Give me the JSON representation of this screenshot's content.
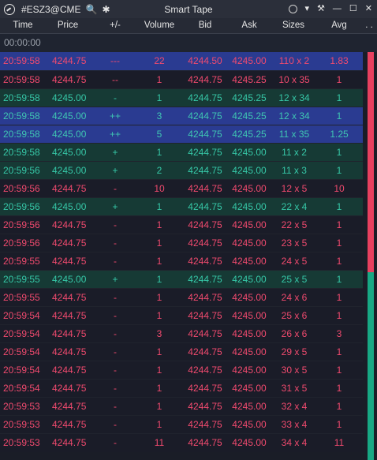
{
  "titlebar": {
    "symbol": "#ESZ3@CME",
    "search_icon": "🔍",
    "settings_icon": "✱",
    "title": "Smart Tape",
    "dropdown_icon": "▾",
    "pin_icon": "⚒",
    "minimize_icon": "—",
    "maximize_icon": "☐",
    "close_icon": "✕"
  },
  "columns": {
    "time": "Time",
    "price": "Price",
    "chg": "+/-",
    "volume": "Volume",
    "bid": "Bid",
    "ask": "Ask",
    "sizes": "Sizes",
    "avg": "Avg",
    "more": ". ."
  },
  "stamp": "00:00:00",
  "colors": {
    "buy_text": "#36c7a7",
    "sell_text": "#f04a6e",
    "highlight_bg": "#2a3b91",
    "buy_row_bg": "#163a35",
    "sell_row_bg": "#1a1c28"
  },
  "imbalance_bar": {
    "sell_fraction": 0.54,
    "buy_fraction": 0.46
  },
  "rows": [
    {
      "side": "sell",
      "hl": true,
      "time": "20:59:58",
      "price": "4244.75",
      "chg": "---",
      "volume": "22",
      "bid": "4244.50",
      "ask": "4245.00",
      "sizes": "110 x 2",
      "avg": "1.83"
    },
    {
      "side": "sell",
      "hl": false,
      "time": "20:59:58",
      "price": "4244.75",
      "chg": "--",
      "volume": "1",
      "bid": "4244.75",
      "ask": "4245.25",
      "sizes": "10 x 35",
      "avg": "1"
    },
    {
      "side": "buy",
      "hl": false,
      "time": "20:59:58",
      "price": "4245.00",
      "chg": "-",
      "volume": "1",
      "bid": "4244.75",
      "ask": "4245.25",
      "sizes": "12 x 34",
      "avg": "1"
    },
    {
      "side": "buy",
      "hl": true,
      "time": "20:59:58",
      "price": "4245.00",
      "chg": "++",
      "volume": "3",
      "bid": "4244.75",
      "ask": "4245.25",
      "sizes": "12 x 34",
      "avg": "1"
    },
    {
      "side": "buy",
      "hl": true,
      "time": "20:59:58",
      "price": "4245.00",
      "chg": "++",
      "volume": "5",
      "bid": "4244.75",
      "ask": "4245.25",
      "sizes": "11 x 35",
      "avg": "1.25"
    },
    {
      "side": "buy",
      "hl": false,
      "time": "20:59:58",
      "price": "4245.00",
      "chg": "+",
      "volume": "1",
      "bid": "4244.75",
      "ask": "4245.00",
      "sizes": "11 x 2",
      "avg": "1"
    },
    {
      "side": "buy",
      "hl": false,
      "time": "20:59:56",
      "price": "4245.00",
      "chg": "+",
      "volume": "2",
      "bid": "4244.75",
      "ask": "4245.00",
      "sizes": "11 x 3",
      "avg": "1"
    },
    {
      "side": "sell",
      "hl": false,
      "time": "20:59:56",
      "price": "4244.75",
      "chg": "-",
      "volume": "10",
      "bid": "4244.75",
      "ask": "4245.00",
      "sizes": "12 x 5",
      "avg": "10"
    },
    {
      "side": "buy",
      "hl": false,
      "time": "20:59:56",
      "price": "4245.00",
      "chg": "+",
      "volume": "1",
      "bid": "4244.75",
      "ask": "4245.00",
      "sizes": "22 x 4",
      "avg": "1"
    },
    {
      "side": "sell",
      "hl": false,
      "time": "20:59:56",
      "price": "4244.75",
      "chg": "-",
      "volume": "1",
      "bid": "4244.75",
      "ask": "4245.00",
      "sizes": "22 x 5",
      "avg": "1"
    },
    {
      "side": "sell",
      "hl": false,
      "time": "20:59:56",
      "price": "4244.75",
      "chg": "-",
      "volume": "1",
      "bid": "4244.75",
      "ask": "4245.00",
      "sizes": "23 x 5",
      "avg": "1"
    },
    {
      "side": "sell",
      "hl": false,
      "time": "20:59:55",
      "price": "4244.75",
      "chg": "-",
      "volume": "1",
      "bid": "4244.75",
      "ask": "4245.00",
      "sizes": "24 x 5",
      "avg": "1"
    },
    {
      "side": "buy",
      "hl": false,
      "time": "20:59:55",
      "price": "4245.00",
      "chg": "+",
      "volume": "1",
      "bid": "4244.75",
      "ask": "4245.00",
      "sizes": "25 x 5",
      "avg": "1"
    },
    {
      "side": "sell",
      "hl": false,
      "time": "20:59:55",
      "price": "4244.75",
      "chg": "-",
      "volume": "1",
      "bid": "4244.75",
      "ask": "4245.00",
      "sizes": "24 x 6",
      "avg": "1"
    },
    {
      "side": "sell",
      "hl": false,
      "time": "20:59:54",
      "price": "4244.75",
      "chg": "-",
      "volume": "1",
      "bid": "4244.75",
      "ask": "4245.00",
      "sizes": "25 x 6",
      "avg": "1"
    },
    {
      "side": "sell",
      "hl": false,
      "time": "20:59:54",
      "price": "4244.75",
      "chg": "-",
      "volume": "3",
      "bid": "4244.75",
      "ask": "4245.00",
      "sizes": "26 x 6",
      "avg": "3"
    },
    {
      "side": "sell",
      "hl": false,
      "time": "20:59:54",
      "price": "4244.75",
      "chg": "-",
      "volume": "1",
      "bid": "4244.75",
      "ask": "4245.00",
      "sizes": "29 x 5",
      "avg": "1"
    },
    {
      "side": "sell",
      "hl": false,
      "time": "20:59:54",
      "price": "4244.75",
      "chg": "-",
      "volume": "1",
      "bid": "4244.75",
      "ask": "4245.00",
      "sizes": "30 x 5",
      "avg": "1"
    },
    {
      "side": "sell",
      "hl": false,
      "time": "20:59:54",
      "price": "4244.75",
      "chg": "-",
      "volume": "1",
      "bid": "4244.75",
      "ask": "4245.00",
      "sizes": "31 x 5",
      "avg": "1"
    },
    {
      "side": "sell",
      "hl": false,
      "time": "20:59:53",
      "price": "4244.75",
      "chg": "-",
      "volume": "1",
      "bid": "4244.75",
      "ask": "4245.00",
      "sizes": "32 x 4",
      "avg": "1"
    },
    {
      "side": "sell",
      "hl": false,
      "time": "20:59:53",
      "price": "4244.75",
      "chg": "-",
      "volume": "1",
      "bid": "4244.75",
      "ask": "4245.00",
      "sizes": "33 x 4",
      "avg": "1"
    },
    {
      "side": "sell",
      "hl": false,
      "time": "20:59:53",
      "price": "4244.75",
      "chg": "-",
      "volume": "11",
      "bid": "4244.75",
      "ask": "4245.00",
      "sizes": "34 x 4",
      "avg": "11"
    }
  ]
}
